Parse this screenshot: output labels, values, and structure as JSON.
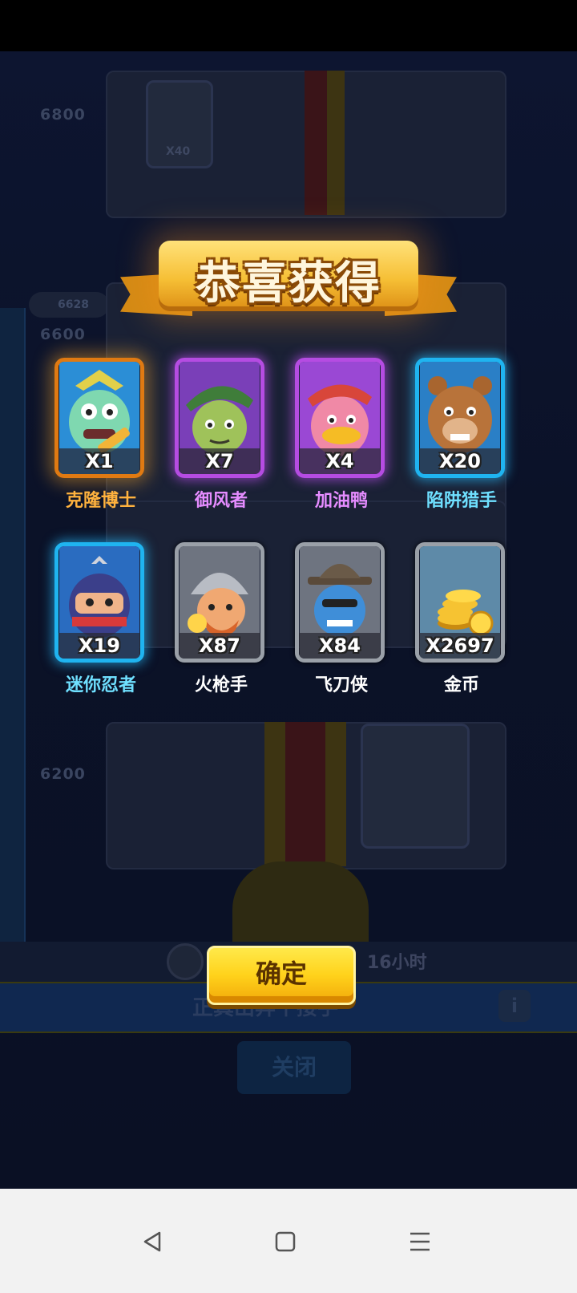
{
  "banner": {
    "title": "恭喜获得"
  },
  "rewards": [
    {
      "name": "克隆博士",
      "count": "X1",
      "rarity": "gold",
      "name_color": "#ffb23e"
    },
    {
      "name": "御风者",
      "count": "X7",
      "rarity": "purple",
      "name_color": "#e58cff"
    },
    {
      "name": "加油鸭",
      "count": "X4",
      "rarity": "purple",
      "name_color": "#e58cff"
    },
    {
      "name": "陷阱猎手",
      "count": "X20",
      "rarity": "blue",
      "name_color": "#6fe0ff"
    },
    {
      "name": "迷你忍者",
      "count": "X19",
      "rarity": "blue",
      "name_color": "#6fe0ff"
    },
    {
      "name": "火枪手",
      "count": "X87",
      "rarity": "gray",
      "name_color": "#ffffff"
    },
    {
      "name": "飞刀侠",
      "count": "X84",
      "rarity": "gray",
      "name_color": "#ffffff"
    },
    {
      "name": "金币",
      "count": "X2697",
      "rarity": "gray",
      "name_color": "#ffffff"
    }
  ],
  "confirm_label": "确定",
  "background": {
    "milestone_1": "6800",
    "milestone_2": "6600",
    "milestone_3": "6200",
    "trophy_count": "6628",
    "chest_count": "X40",
    "timer_text": "16小时",
    "close_label": "关闭",
    "blue_bar_text": "正真出奔个接手",
    "info_glyph": "i"
  },
  "nav": {
    "back_icon": "back-triangle-icon",
    "home_icon": "home-square-icon",
    "menu_icon": "menu-lines-icon"
  }
}
